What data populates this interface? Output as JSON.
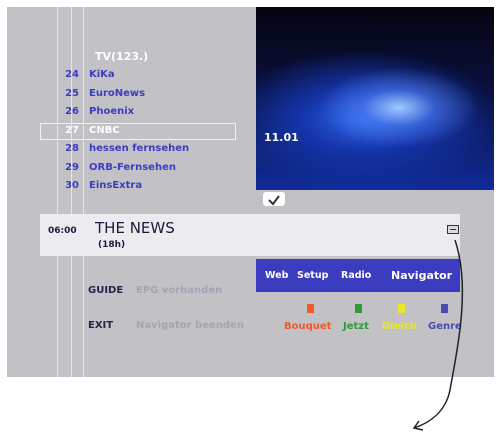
{
  "group_title": "TV(123.)",
  "channels": [
    {
      "num": "24",
      "name": "KiKa"
    },
    {
      "num": "25",
      "name": "EuroNews"
    },
    {
      "num": "26",
      "name": "Phoenix"
    },
    {
      "num": "27",
      "name": "CNBC"
    },
    {
      "num": "28",
      "name": "hessen fernsehen"
    },
    {
      "num": "29",
      "name": "ORB-Fernsehen"
    },
    {
      "num": "30",
      "name": "EinsExtra"
    }
  ],
  "selected_channel_index": 3,
  "video": {
    "time": "11.01"
  },
  "epg": {
    "time": "06:00",
    "title": "THE NEWS",
    "duration": "(18h)"
  },
  "nav_menu": [
    "Web",
    "Setup",
    "Radio",
    "Navigator"
  ],
  "help": {
    "guide_key": "GUIDE",
    "guide_text": "EPG vorhanden",
    "exit_key": "EXIT",
    "exit_text": "Navigator beenden"
  },
  "color_keys": [
    {
      "label": "Bouquet",
      "color": "#f05a28"
    },
    {
      "label": "Jetzt",
      "color": "#2f9a3a"
    },
    {
      "label": "Gleich",
      "color": "#e8e82a"
    },
    {
      "label": "Genre",
      "color": "#4a4ab0"
    }
  ],
  "icons": {
    "epg_info": "epg-info-icon",
    "check": "checkmark-icon"
  }
}
